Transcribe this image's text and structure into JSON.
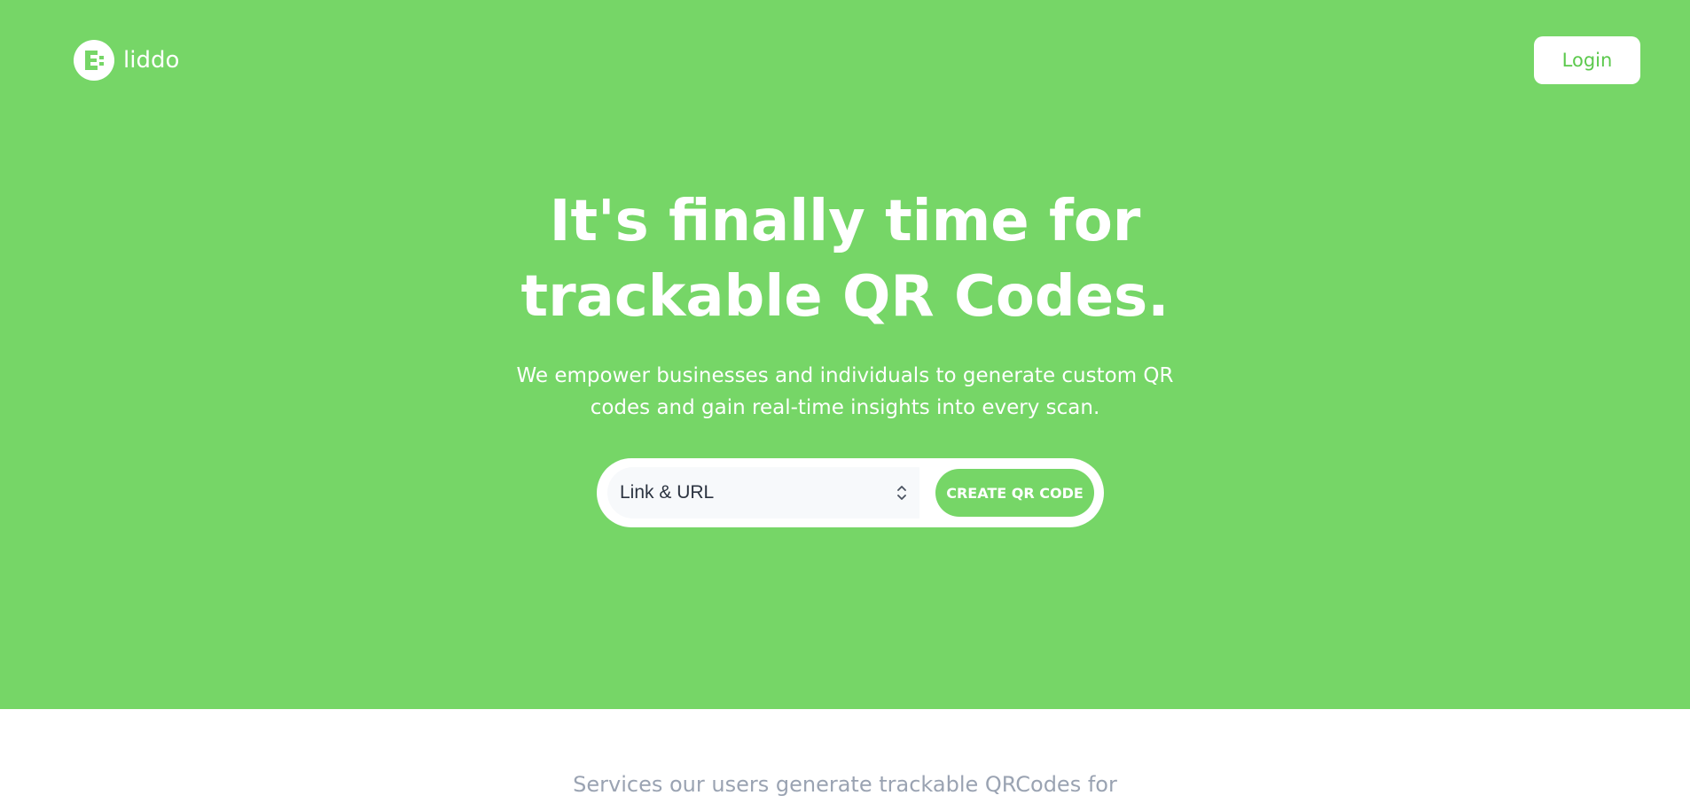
{
  "brand": {
    "name": "liddo",
    "icon": "liddo-logo-icon"
  },
  "header": {
    "login_label": "Login"
  },
  "hero": {
    "headline_line1": "It's finally time for",
    "headline_line2": "trackable QR Codes.",
    "subline_line1": "We empower businesses and individuals to generate custom QR",
    "subline_line2": "codes and gain real-time insights into every scan."
  },
  "form": {
    "select_value": "Link & URL",
    "select_icon": "chevron-up-down-icon",
    "create_label": "CREATE QR CODE"
  },
  "services": {
    "heading": "Services our users generate trackable QRCodes for"
  },
  "colors": {
    "brand_green": "#76d667",
    "login_text": "#5cc94d",
    "white": "#ffffff",
    "muted_text": "#9aa3b2"
  }
}
